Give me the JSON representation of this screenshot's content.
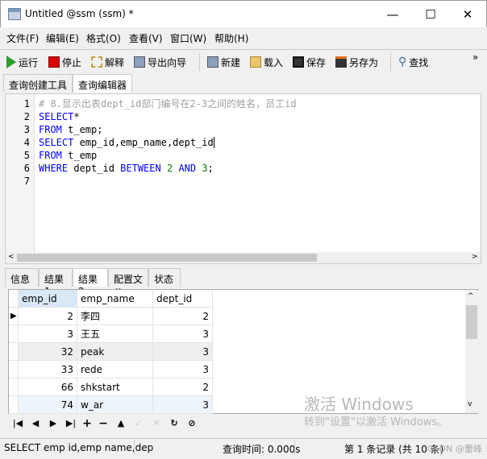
{
  "window": {
    "title": "Untitled @ssm (ssm) *",
    "minimize": "—",
    "maximize": "☐",
    "close": "✕"
  },
  "menu": [
    "文件(F)",
    "编辑(E)",
    "格式(O)",
    "查看(V)",
    "窗口(W)",
    "帮助(H)"
  ],
  "toolbar": {
    "run": "运行",
    "stop": "停止",
    "explain": "解释",
    "export": "导出向导",
    "new": "新建",
    "load": "载入",
    "save": "保存",
    "save_as": "另存为",
    "find": "查找",
    "overflow": "»"
  },
  "editor_tabs": [
    "查询创建工具",
    "查询编辑器"
  ],
  "code": {
    "line_numbers": [
      "1",
      "2",
      "3",
      "4",
      "5",
      "6",
      "7"
    ],
    "lines": [
      [
        [
          "cm",
          "# 8.显示出表dept_id部门编号在2-3之间的姓名，员工id"
        ]
      ],
      [
        [
          "kw",
          "SELECT"
        ],
        [
          "",
          "*"
        ]
      ],
      [
        [
          "kw",
          "FROM"
        ],
        [
          "",
          " t_emp;"
        ]
      ],
      [
        [
          "kw",
          "SELECT"
        ],
        [
          "",
          " emp_id,emp_name,dept_id"
        ]
      ],
      [
        [
          "kw",
          "FROM"
        ],
        [
          "",
          " t_emp"
        ]
      ],
      [
        [
          "kw",
          "WHERE"
        ],
        [
          "",
          " dept_id "
        ],
        [
          "kw",
          "BETWEEN"
        ],
        [
          "",
          " "
        ],
        [
          "num",
          "2"
        ],
        [
          "",
          " "
        ],
        [
          "kw",
          "AND"
        ],
        [
          "",
          " "
        ],
        [
          "num",
          "3"
        ],
        [
          "",
          ";"
        ]
      ],
      []
    ]
  },
  "result_tabs": [
    "信息",
    "结果1",
    "结果2",
    "配置文件",
    "状态"
  ],
  "grid": {
    "columns": [
      "emp_id",
      "emp_name",
      "dept_id"
    ],
    "rows": [
      [
        "2",
        "李四",
        "2"
      ],
      [
        "3",
        "王五",
        "3"
      ],
      [
        "32",
        "peak",
        "3"
      ],
      [
        "33",
        "rede",
        "3"
      ],
      [
        "66",
        "shkstart",
        "2"
      ],
      [
        "74",
        "w_ar",
        "3"
      ]
    ]
  },
  "status": {
    "sql": "SELECT emp id,emp name,dep",
    "query_time": "查询时间: 0.000s",
    "record": "第 1 条记录 (共 10 条)",
    "credit": "CSDN @蕾峰"
  },
  "watermark": {
    "line1": "激活 Windows",
    "line2": "转到\"设置\"以激活 Windows。"
  }
}
